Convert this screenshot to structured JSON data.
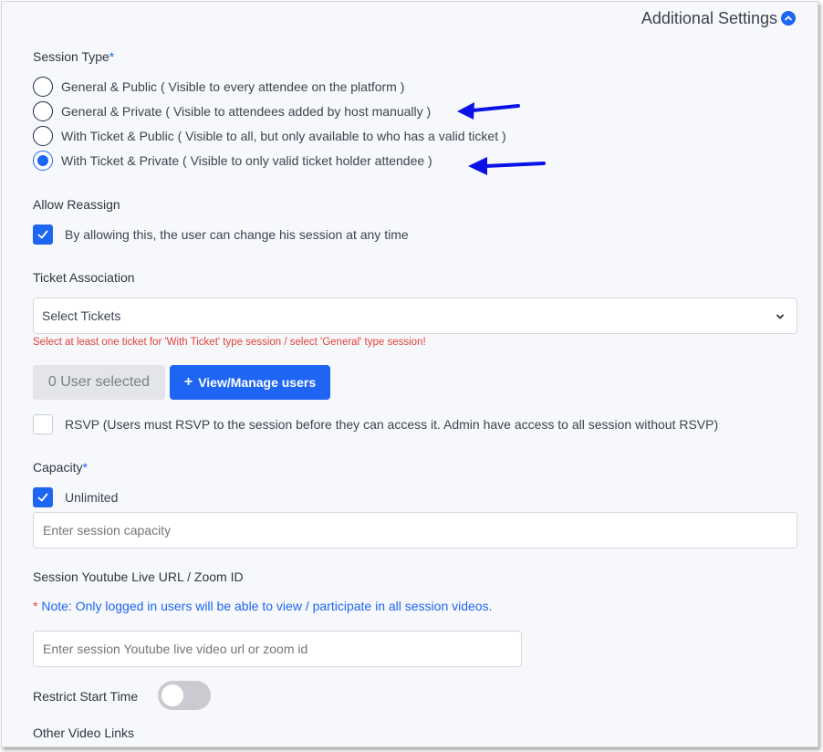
{
  "header": {
    "title": "Additional Settings",
    "chevron_icon": "chevron-up-icon"
  },
  "session_type": {
    "label": "Session Type",
    "required_mark": "*",
    "options": [
      {
        "label": "General & Public ( Visible to every attendee on the platform )",
        "selected": false
      },
      {
        "label": "General & Private ( Visible to attendees added by host manually )",
        "selected": false
      },
      {
        "label": "With Ticket & Public ( Visible to all, but only available to who has a valid ticket )",
        "selected": false
      },
      {
        "label": "With Ticket & Private ( Visible to only valid ticket holder attendee )",
        "selected": true
      }
    ]
  },
  "allow_reassign": {
    "label": "Allow Reassign",
    "checkbox_label": "By allowing this, the user can change his session at any time",
    "checked": true
  },
  "ticket_association": {
    "label": "Ticket Association",
    "select_value": "Select Tickets",
    "error": "Select at least one ticket for 'With Ticket' type session / select 'General' type session!"
  },
  "users": {
    "selected_label": "0 User selected",
    "manage_button": "View/Manage users"
  },
  "rsvp": {
    "checkbox_label": "RSVP (Users must RSVP to the session before they can access it. Admin have access to all session without RSVP)",
    "checked": false
  },
  "capacity": {
    "label": "Capacity",
    "required_mark": "*",
    "unlimited_label": "Unlimited",
    "unlimited_checked": true,
    "placeholder": "Enter session capacity"
  },
  "video": {
    "label": "Session Youtube Live URL / Zoom ID",
    "note_star": "*",
    "note": " Note: Only logged in users will be able to view / participate in all session videos.",
    "placeholder": "Enter session Youtube live video url or zoom id"
  },
  "restrict_start": {
    "label": "Restrict Start Time",
    "enabled": false
  },
  "other_video_links": {
    "label": "Other Video Links"
  },
  "colors": {
    "accent": "#1d65f2",
    "error": "#e0433b",
    "arrow": "#0a12e8"
  }
}
